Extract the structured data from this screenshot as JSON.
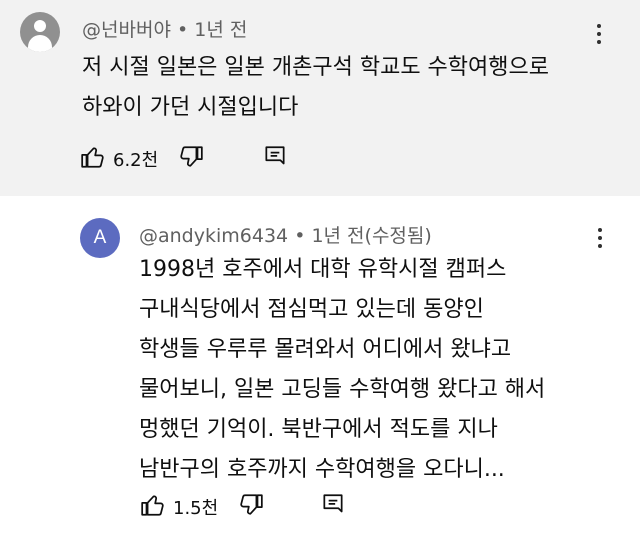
{
  "comments": [
    {
      "author": "@넌바버야",
      "separator": "•",
      "time": "1년 전",
      "lines": [
        "저 시절 일본은 일본 개촌구석 학교도 수학여행으로",
        "하와이 가던 시절입니다"
      ],
      "likes": "6.2천",
      "avatar_icon": "default-user-avatar-icon"
    },
    {
      "author": "@andykim6434",
      "separator": "•",
      "time": "1년 전(수정됨)",
      "avatar_letter": "A",
      "lines": [
        "1998년 호주에서 대학 유학시절 캠퍼스",
        "구내식당에서 점심먹고 있는데 동양인",
        "학생들 우루루 몰려와서 어디에서 왔냐고",
        "물어보니, 일본 고딩들 수학여행 왔다고 해서",
        "멍했던 기억이. 북반구에서 적도를 지나",
        "남반구의 호주까지 수학여행을 오다니..."
      ],
      "likes": "1.5천"
    }
  ],
  "colors": {
    "top_bg": "#f2f2f2",
    "avatar_a": "#5c6bc0",
    "meta": "#606060"
  }
}
